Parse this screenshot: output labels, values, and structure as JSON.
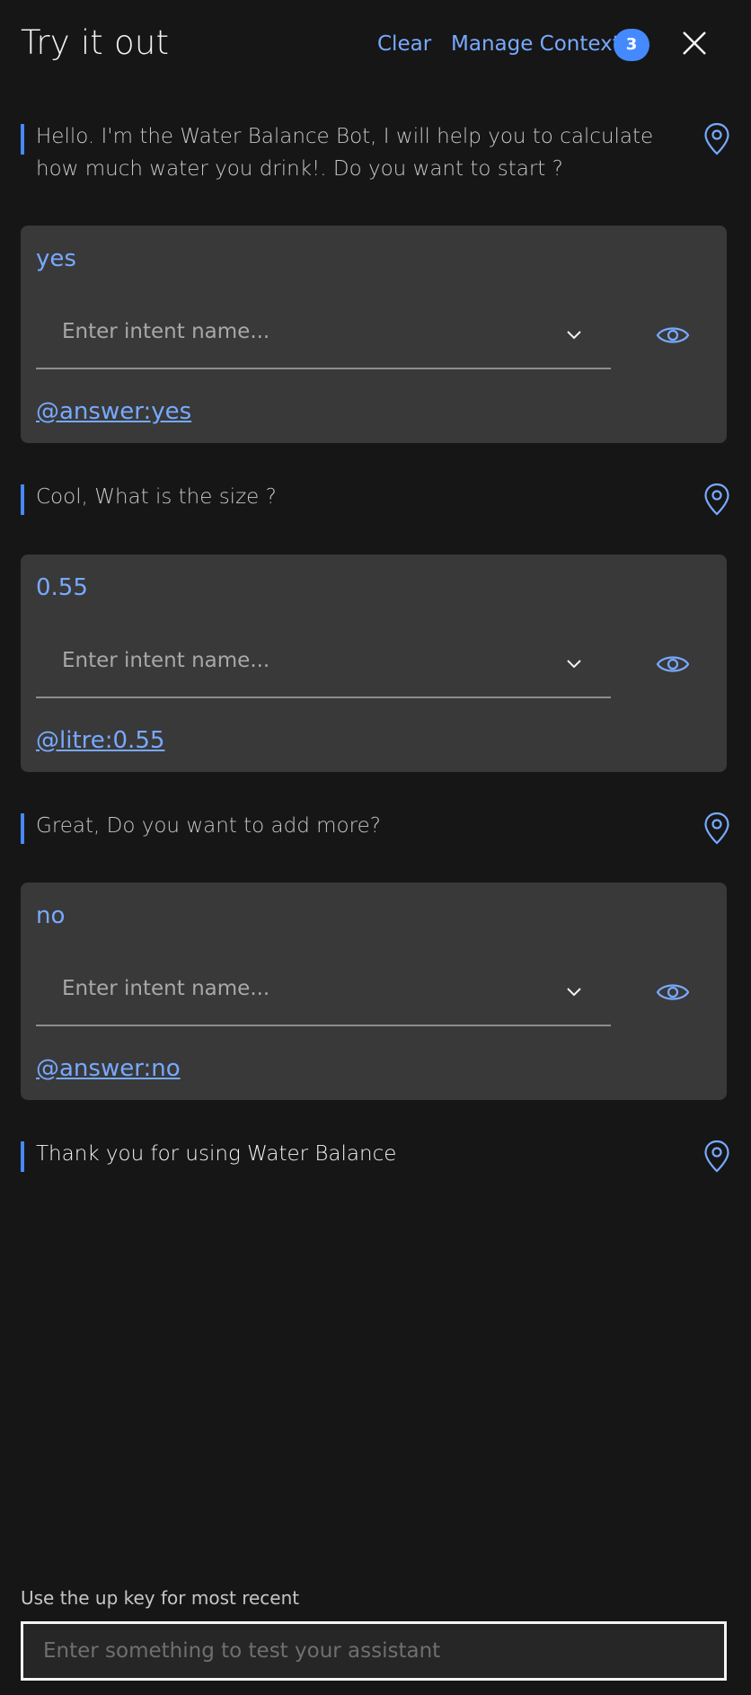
{
  "header": {
    "title": "Try it out",
    "clear_label": "Clear",
    "manage_context_label": "Manage Context",
    "context_count": "3",
    "close_icon": "close-icon"
  },
  "conversation": {
    "bot_messages": [
      {
        "line1": "Hello. I'm the Water Balance Bot, I will help you to calculate",
        "line2": "how much water you drink!. Do you want to start ?"
      },
      {
        "text": "Cool, What is the size ?"
      },
      {
        "text": "Great, Do you want to add more?"
      },
      {
        "text": "Thank you for using Water Balance"
      }
    ],
    "user_messages": [
      {
        "text": "yes",
        "intent_placeholder": "Enter intent name...",
        "entity": "@answer:yes"
      },
      {
        "text": "0.55",
        "intent_placeholder": "Enter intent name...",
        "entity": "@litre:0.55"
      },
      {
        "text": "no",
        "intent_placeholder": "Enter intent name...",
        "entity": "@answer:no"
      }
    ]
  },
  "footer": {
    "hint": "Use the up key for most recent",
    "input_placeholder": "Enter something to test your assistant",
    "input_value": ""
  },
  "colors": {
    "background": "#161616",
    "card": "#393939",
    "accent": "#78a9ff",
    "badge": "#4589ff"
  }
}
